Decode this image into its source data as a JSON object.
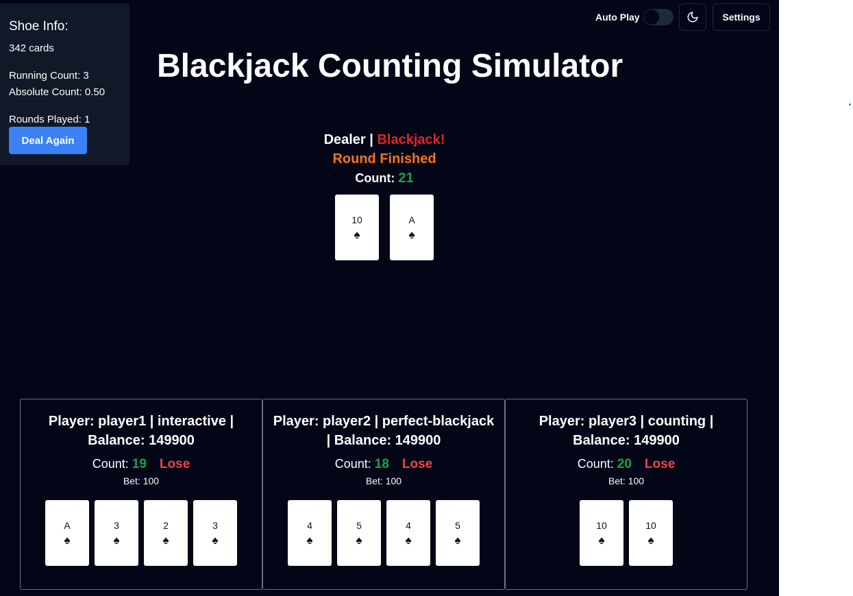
{
  "shoe": {
    "title": "Shoe Info:",
    "cards": "342 cards",
    "running_count": "Running Count: 3",
    "absolute_count": "Absolute Count: 0.50",
    "rounds_played": "Rounds Played: 1",
    "deal_again": "Deal Again"
  },
  "controls": {
    "auto_play_label": "Auto Play",
    "auto_play_on": false,
    "theme_icon": "moon-icon",
    "settings_label": "Settings"
  },
  "title": "Blackjack Counting Simulator",
  "dealer": {
    "label": "Dealer",
    "separator": "|",
    "result": "Blackjack!",
    "round_status": "Round Finished",
    "count_label": "Count:",
    "count_value": "21",
    "cards": [
      {
        "rank": "10",
        "suit": "♠"
      },
      {
        "rank": "A",
        "suit": "♠"
      }
    ]
  },
  "players": [
    {
      "title": "Player: player1 | interactive | Balance: 149900",
      "count_label": "Count:",
      "count_value": "19",
      "result": "Lose",
      "bet": "Bet: 100",
      "cards": [
        {
          "rank": "A",
          "suit": "♠"
        },
        {
          "rank": "3",
          "suit": "♠"
        },
        {
          "rank": "2",
          "suit": "♠"
        },
        {
          "rank": "3",
          "suit": "♠"
        }
      ]
    },
    {
      "title": "Player: player2 | perfect-blackjack | Balance: 149900",
      "count_label": "Count:",
      "count_value": "18",
      "result": "Lose",
      "bet": "Bet: 100",
      "cards": [
        {
          "rank": "4",
          "suit": "♠"
        },
        {
          "rank": "5",
          "suit": "♠"
        },
        {
          "rank": "4",
          "suit": "♠"
        },
        {
          "rank": "5",
          "suit": "♠"
        }
      ]
    },
    {
      "title": "Player: player3 | counting | Balance: 149900",
      "count_label": "Count:",
      "count_value": "20",
      "result": "Lose",
      "bet": "Bet: 100",
      "cards": [
        {
          "rank": "10",
          "suit": "♠"
        },
        {
          "rank": "10",
          "suit": "♠"
        }
      ]
    }
  ],
  "colors": {
    "background": "#020617",
    "panel": "#111827",
    "accent_blue": "#3b82f6",
    "result_red": "#dc2626",
    "status_orange": "#f97316",
    "count_green": "#16a34a"
  }
}
